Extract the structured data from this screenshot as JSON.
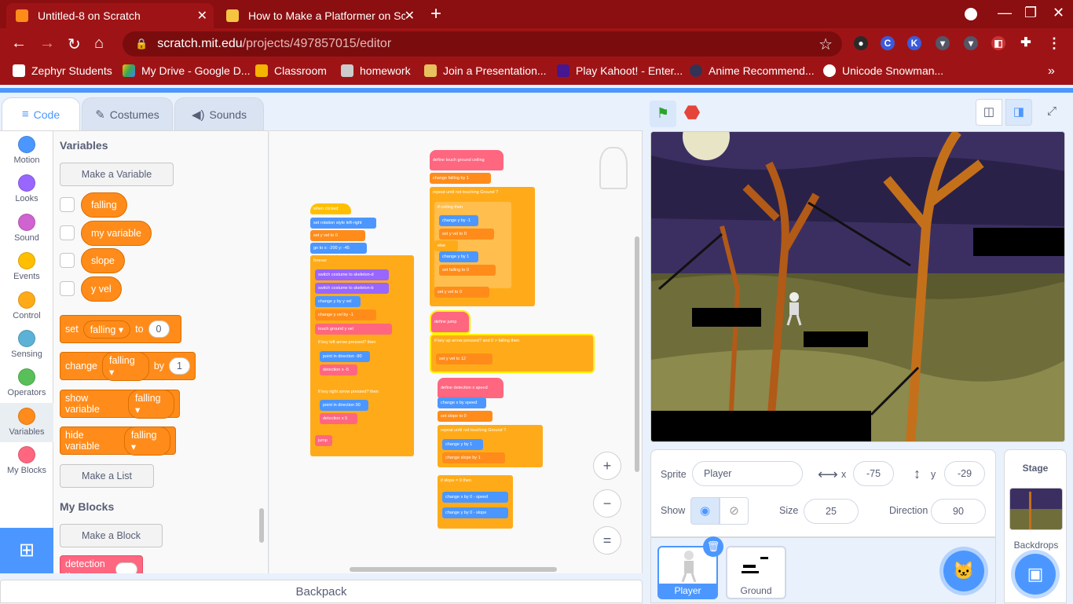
{
  "browser": {
    "tabs": [
      {
        "title": "Untitled-8 on Scratch",
        "active": true
      },
      {
        "title": "How to Make a Platformer on Sc",
        "active": false
      }
    ],
    "url_host": "scratch.mit.edu",
    "url_path": "/projects/497857015/editor",
    "bookmarks": [
      {
        "label": "Zephyr Students"
      },
      {
        "label": "My Drive - Google D..."
      },
      {
        "label": "Classroom"
      },
      {
        "label": "homework"
      },
      {
        "label": "Join a Presentation..."
      },
      {
        "label": "Play Kahoot! - Enter..."
      },
      {
        "label": "Anime Recommend..."
      },
      {
        "label": "Unicode Snowman..."
      }
    ],
    "more": "»"
  },
  "editor": {
    "tabs": {
      "code": "Code",
      "costumes": "Costumes",
      "sounds": "Sounds"
    },
    "categories": [
      {
        "label": "Motion",
        "color": "#4c97ff"
      },
      {
        "label": "Looks",
        "color": "#9966ff"
      },
      {
        "label": "Sound",
        "color": "#cf63cf"
      },
      {
        "label": "Events",
        "color": "#ffbf00"
      },
      {
        "label": "Control",
        "color": "#ffab19"
      },
      {
        "label": "Sensing",
        "color": "#5cb1d6"
      },
      {
        "label": "Operators",
        "color": "#59c059"
      },
      {
        "label": "Variables",
        "color": "#ff8c1a"
      },
      {
        "label": "My Blocks",
        "color": "#ff6680"
      }
    ],
    "palette": {
      "variables_title": "Variables",
      "make_variable": "Make a Variable",
      "variables": [
        "falling",
        "my variable",
        "slope",
        "y vel"
      ],
      "set_block": {
        "verb": "set",
        "var": "falling",
        "to": "to",
        "value": "0"
      },
      "change_block": {
        "verb": "change",
        "var": "falling",
        "by": "by",
        "value": "1"
      },
      "show_block": {
        "verb": "show variable",
        "var": "falling"
      },
      "hide_block": {
        "verb": "hide variable",
        "var": "falling"
      },
      "make_list": "Make a List",
      "myblocks_title": "My Blocks",
      "make_block": "Make a Block",
      "detection_block": "detection x"
    },
    "backpack": "Backpack"
  },
  "scripts": {
    "main": [
      "when clicked",
      "set rotation style left-right",
      "set y vel to 0",
      "go to x: -200 y: -45",
      "forever",
      "switch costume to skeleton-d",
      "switch costume to skeleton-b",
      "change y by y vel",
      "change y vel by -1",
      "touch ground y vel",
      "if key left arrow pressed? then",
      "point in direction -90",
      "detection x -5",
      "if key right arrow pressed? then",
      "point in direction 90",
      "detection x 5",
      "jump"
    ],
    "touch_ground": [
      "define touch ground ceiling",
      "change falling by 1",
      "repeat until not touching Ground ?",
      "if ceiling then",
      "change y by -1",
      "set y vel to 0",
      "else",
      "change y by 1",
      "set falling to 0",
      "set y vel to 0"
    ],
    "jump": [
      "define jump",
      "if key up arrow pressed? and 0 > falling then",
      "set y vel to 12"
    ],
    "detection": [
      "define detection x speed",
      "change x by speed",
      "set slope to 0",
      "repeat until not touching Ground ?",
      "change y by 1",
      "change slope by 1",
      "if slope = 9 then",
      "change x by 0 - speed",
      "change y by 0 - slope"
    ]
  },
  "sprite_info": {
    "sprite_label": "Sprite",
    "sprite_name": "Player",
    "x_label": "x",
    "x_value": "-75",
    "y_label": "y",
    "y_value": "-29",
    "show_label": "Show",
    "size_label": "Size",
    "size_value": "25",
    "direction_label": "Direction",
    "direction_value": "90"
  },
  "sprites": [
    {
      "name": "Player",
      "selected": true
    },
    {
      "name": "Ground",
      "selected": false
    }
  ],
  "stage_panel": {
    "title": "Stage",
    "backdrops": "Backdrops"
  }
}
